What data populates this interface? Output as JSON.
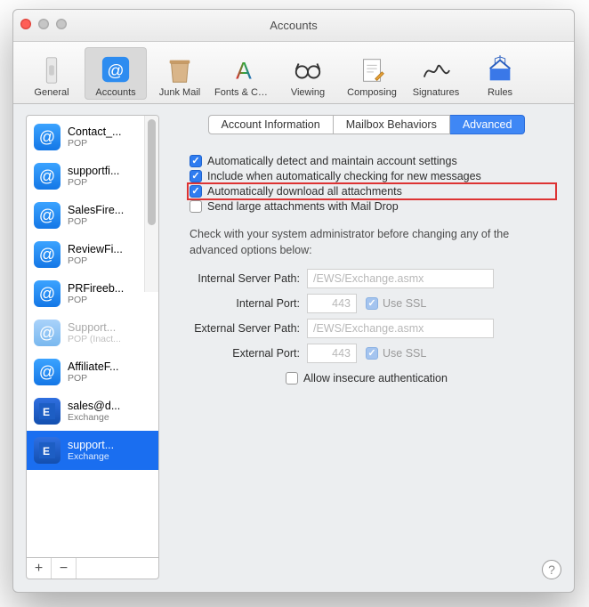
{
  "window": {
    "title": "Accounts"
  },
  "toolbar": {
    "items": [
      {
        "label": "General",
        "icon": "switch-icon",
        "selected": false
      },
      {
        "label": "Accounts",
        "icon": "at-icon",
        "selected": true
      },
      {
        "label": "Junk Mail",
        "icon": "trash-icon",
        "selected": false
      },
      {
        "label": "Fonts & Colors",
        "icon": "font-icon",
        "selected": false
      },
      {
        "label": "Viewing",
        "icon": "glasses-icon",
        "selected": false
      },
      {
        "label": "Composing",
        "icon": "paper-icon",
        "selected": false
      },
      {
        "label": "Signatures",
        "icon": "signature-icon",
        "selected": false
      },
      {
        "label": "Rules",
        "icon": "rules-icon",
        "selected": false
      }
    ]
  },
  "sidebar": {
    "accounts": [
      {
        "name": "Contact_...",
        "type": "POP",
        "icon": "at",
        "selected": false,
        "dimmed": false
      },
      {
        "name": "supportfi...",
        "type": "POP",
        "icon": "at",
        "selected": false,
        "dimmed": false
      },
      {
        "name": "SalesFire...",
        "type": "POP",
        "icon": "at",
        "selected": false,
        "dimmed": false
      },
      {
        "name": "ReviewFi...",
        "type": "POP",
        "icon": "at",
        "selected": false,
        "dimmed": false
      },
      {
        "name": "PRFireeb...",
        "type": "POP",
        "icon": "at",
        "selected": false,
        "dimmed": false
      },
      {
        "name": "Support...",
        "type": "POP (Inact...",
        "icon": "at-dim",
        "selected": false,
        "dimmed": true
      },
      {
        "name": "AffiliateF...",
        "type": "POP",
        "icon": "at",
        "selected": false,
        "dimmed": false
      },
      {
        "name": "sales@d...",
        "type": "Exchange",
        "icon": "exchange",
        "selected": false,
        "dimmed": false
      },
      {
        "name": "support...",
        "type": "Exchange",
        "icon": "exchange",
        "selected": true,
        "dimmed": false
      }
    ],
    "add_label": "+",
    "remove_label": "−"
  },
  "tabs": [
    {
      "label": "Account Information",
      "selected": false
    },
    {
      "label": "Mailbox Behaviors",
      "selected": false
    },
    {
      "label": "Advanced",
      "selected": true
    }
  ],
  "advanced": {
    "checkboxes": [
      {
        "label": "Automatically detect and maintain account settings",
        "checked": true,
        "highlighted": false
      },
      {
        "label": "Include when automatically checking for new messages",
        "checked": true,
        "highlighted": false
      },
      {
        "label": "Automatically download all attachments",
        "checked": true,
        "highlighted": true
      },
      {
        "label": "Send large attachments with Mail Drop",
        "checked": false,
        "highlighted": false
      }
    ],
    "hint": "Check with your system administrator before changing any of the advanced options below:",
    "internal_server_path_label": "Internal Server Path:",
    "internal_server_path_value": "/EWS/Exchange.asmx",
    "internal_port_label": "Internal Port:",
    "internal_port_value": "443",
    "external_server_path_label": "External Server Path:",
    "external_server_path_value": "/EWS/Exchange.asmx",
    "external_port_label": "External Port:",
    "external_port_value": "443",
    "use_ssl_label": "Use SSL",
    "allow_insecure_label": "Allow insecure authentication"
  },
  "help_label": "?"
}
